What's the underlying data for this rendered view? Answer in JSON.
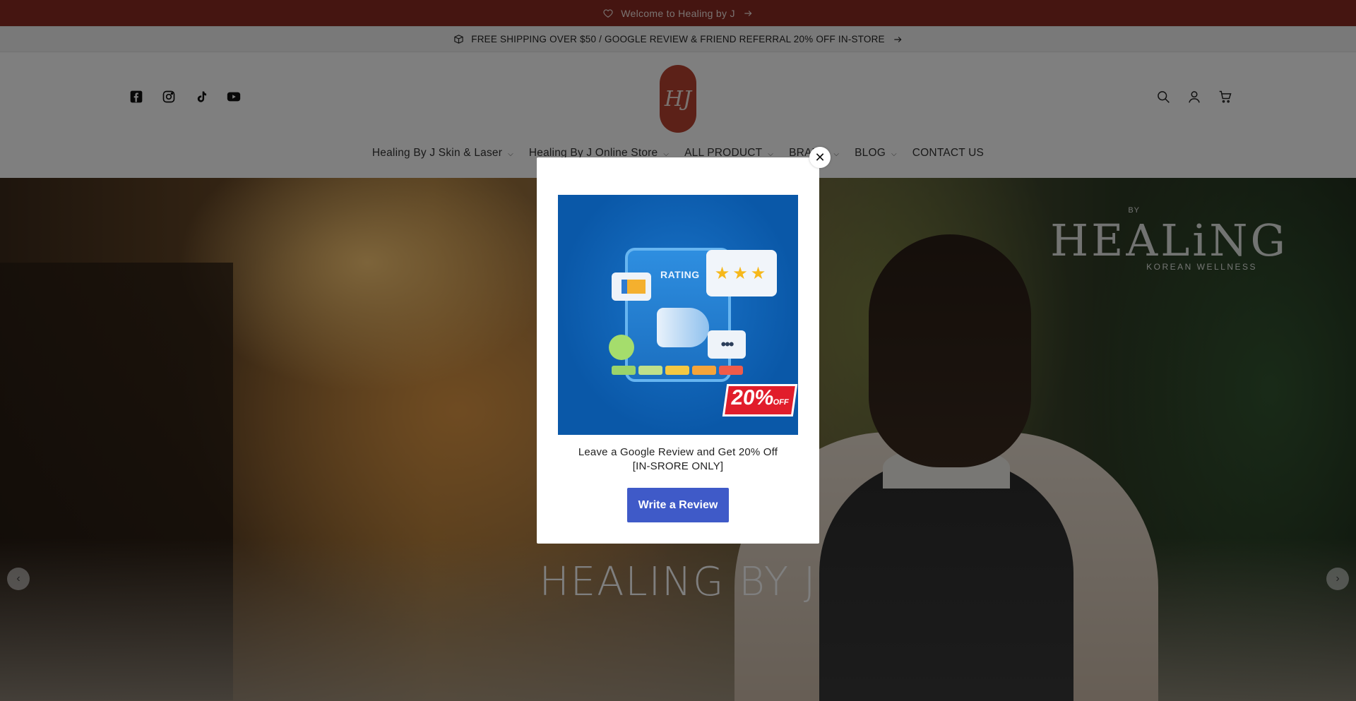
{
  "announcements": {
    "welcome": "Welcome to Healing by J",
    "shipping": "FREE SHIPPING OVER $50 / GOOGLE REVIEW & FRIEND REFERRAL 20% OFF IN-STORE"
  },
  "header": {
    "socials": [
      "facebook-icon",
      "instagram-icon",
      "tiktok-icon",
      "youtube-icon"
    ],
    "logo_text": "HJ",
    "actions": [
      "search-icon",
      "account-icon",
      "cart-icon"
    ]
  },
  "nav": {
    "items": [
      {
        "label": "Healing By J Skin & Laser",
        "dropdown": true
      },
      {
        "label": "Healing By J Online Store",
        "dropdown": true
      },
      {
        "label": "ALL PRODUCT",
        "dropdown": true
      },
      {
        "label": "BRAND",
        "dropdown": true
      },
      {
        "label": "BLOG",
        "dropdown": true
      },
      {
        "label": "CONTACT US",
        "dropdown": false
      }
    ]
  },
  "hero": {
    "brand_big": "HEALiNG",
    "brand_by": "BY",
    "brand_small": "KOREAN WELLNESS",
    "title": "HEALING BY J"
  },
  "popup": {
    "promo": {
      "rating_label": "RATING",
      "stars": "★★★",
      "dots": "•••",
      "discount": "20%",
      "discount_suffix": "OFF"
    },
    "text_line1": "Leave a Google Review and Get 20% Off",
    "text_line2": "[IN-SRORE ONLY]",
    "button_label": "Write a Review",
    "close_symbol": "✕"
  },
  "colors": {
    "top_bar": "#8b2a22",
    "button": "#3f5ac8",
    "logo": "#b84330"
  }
}
